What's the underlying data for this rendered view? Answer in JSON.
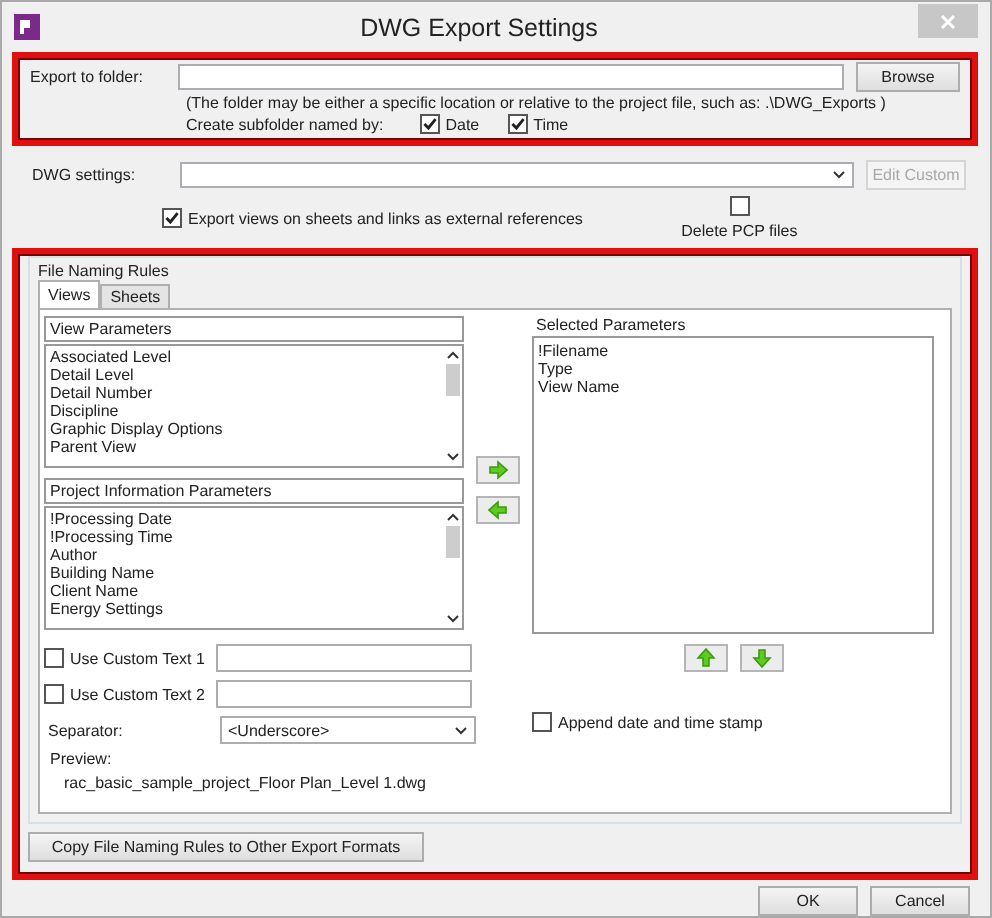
{
  "window": {
    "title": "DWG Export Settings"
  },
  "export_folder": {
    "label": "Export to folder:",
    "browse": "Browse",
    "hint": "(The folder may be either a specific location or relative to the project file, such as:  .\\DWG_Exports )",
    "subfolder_label": "Create subfolder named by:",
    "subfolder_options": [
      {
        "label": "Date",
        "checked": true
      },
      {
        "label": "Time",
        "checked": true
      }
    ]
  },
  "dwg_settings": {
    "label": "DWG settings:",
    "edit_button": {
      "label": "Edit Custom",
      "disabled": true
    }
  },
  "options": [
    {
      "label": "Export views on sheets and links as external references",
      "checked": true
    },
    {
      "label": "Delete PCP files",
      "checked": false
    }
  ],
  "file_naming": {
    "title": "File Naming Rules",
    "tabs": [
      {
        "label": "Views",
        "selected": true
      },
      {
        "label": "Sheets",
        "selected": false
      }
    ],
    "view_parameters": {
      "header": "View Parameters",
      "items": [
        "Associated Level",
        "Detail Level",
        "Detail Number",
        "Discipline",
        "Graphic Display Options",
        "Parent View"
      ]
    },
    "project_parameters": {
      "header": "Project Information Parameters",
      "items": [
        "!Processing Date",
        "!Processing Time",
        "Author",
        "Building Name",
        "Client Name",
        "Energy Settings"
      ]
    },
    "selected_parameters": {
      "header": "Selected Parameters",
      "items": [
        "!Filename",
        "Type",
        "View Name"
      ]
    },
    "custom_texts": [
      {
        "label": "Use Custom Text 1",
        "checked": false
      },
      {
        "label": "Use Custom Text 2",
        "checked": false
      }
    ],
    "separator": {
      "label": "Separator:",
      "value": "<Underscore>"
    },
    "append_stamp": {
      "label": "Append date and time stamp",
      "checked": false
    },
    "preview": {
      "label": "Preview:",
      "value": "rac_basic_sample_project_Floor  Plan_Level  1.dwg"
    },
    "copy_button": "Copy File Naming Rules to Other Export Formats"
  },
  "buttons": [
    "OK",
    "Cancel"
  ]
}
